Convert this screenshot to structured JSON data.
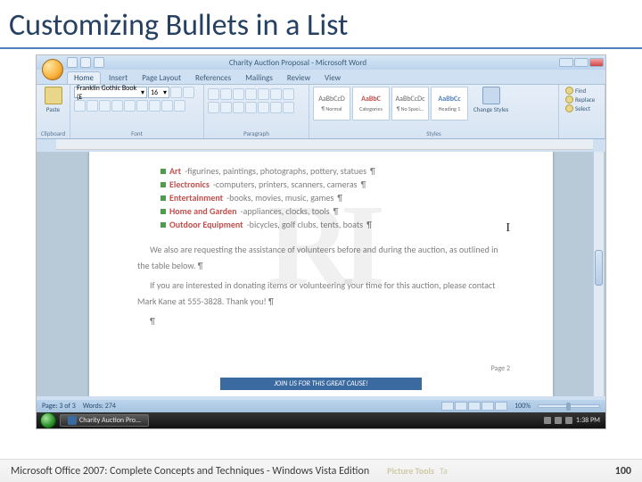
{
  "slide": {
    "title": "Customizing Bullets in a List",
    "footer_text": "Microsoft Office 2007: Complete Concepts and Techniques - Windows Vista Edition",
    "page_number": "100",
    "ghost_label1": "Picture Tools",
    "ghost_label2": "Ta"
  },
  "window": {
    "title": "Charity Auction Proposal - Microsoft Word"
  },
  "ribbon": {
    "tabs": [
      "Home",
      "Insert",
      "Page Layout",
      "References",
      "Mailings",
      "Review",
      "View"
    ],
    "active_tab": "Home",
    "clipboard": {
      "paste": "Paste",
      "label": "Clipboard"
    },
    "font": {
      "name": "Franklin Gothic Book (E",
      "size": "16",
      "label": "Font"
    },
    "paragraph": {
      "label": "Paragraph"
    },
    "styles": {
      "items": [
        {
          "preview": "AaBbCcD",
          "name": "¶ Normal"
        },
        {
          "preview": "AaBbC",
          "name": "Categories"
        },
        {
          "preview": "AaBbCcDc",
          "name": "¶ No Spaci..."
        },
        {
          "preview": "AaBbCc",
          "name": "Heading 1"
        }
      ],
      "change": "Change Styles",
      "label": "Styles"
    },
    "editing": {
      "find": "Find",
      "replace": "Replace",
      "select": "Select"
    }
  },
  "document": {
    "bullets": [
      {
        "bold": "Art",
        "rest": "-figurines, paintings, photographs, pottery, statues"
      },
      {
        "bold": "Electronics",
        "rest": "-computers, printers, scanners, cameras"
      },
      {
        "bold": "Entertainment",
        "rest": "-books, movies, music, games"
      },
      {
        "bold": "Home and Garden",
        "rest": "-appliances, clocks, tools"
      },
      {
        "bold": "Outdoor Equipment",
        "rest": "-bicycles, golf clubs, tents, boats"
      }
    ],
    "para1": "We also are requesting the assistance of volunteers before and during the auction, as outlined in the table below.",
    "para2": "If you are interested in donating items or volunteering your time for this auction, please contact Mark Kane at 555-3828. Thank you!",
    "footer_banner": "JOIN US FOR THIS GREAT CAUSE!",
    "page_label": "Page 2",
    "pilcrow": "¶"
  },
  "statusbar": {
    "page": "Page: 3 of 3",
    "words": "Words: 274",
    "zoom": "100%"
  },
  "taskbar": {
    "app": "Charity Auction Pro...",
    "time": "1:38 PM"
  }
}
